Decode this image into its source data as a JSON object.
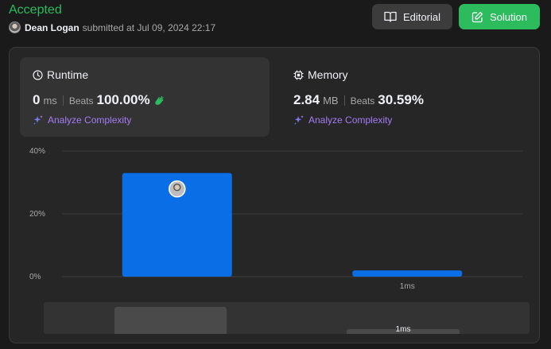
{
  "header": {
    "status": "Accepted",
    "user": "Dean Logan",
    "submitted_text": "submitted at Jul 09, 2024 22:17",
    "editorial_label": "Editorial",
    "solution_label": "Solution"
  },
  "runtime": {
    "title": "Runtime",
    "value": "0",
    "unit": "ms",
    "beats_label": "Beats",
    "beats": "100.00%",
    "analyze_label": "Analyze Complexity"
  },
  "memory": {
    "title": "Memory",
    "value": "2.84",
    "unit": "MB",
    "beats_label": "Beats",
    "beats": "30.59%",
    "analyze_label": "Analyze Complexity"
  },
  "chart_data": {
    "type": "bar",
    "categories": [
      "",
      "1ms"
    ],
    "values": [
      33,
      2
    ],
    "ylim": [
      0,
      40
    ],
    "yticks": [
      "40%",
      "20%",
      "0%"
    ],
    "grid": true,
    "highlight_index": 0,
    "bar_color": "#0a6ee6"
  },
  "minimap": {
    "label": "1ms"
  },
  "colors": {
    "accepted": "#2cbb5d",
    "accent_purple": "#a47cf3",
    "clap": "#2cbb5d"
  }
}
